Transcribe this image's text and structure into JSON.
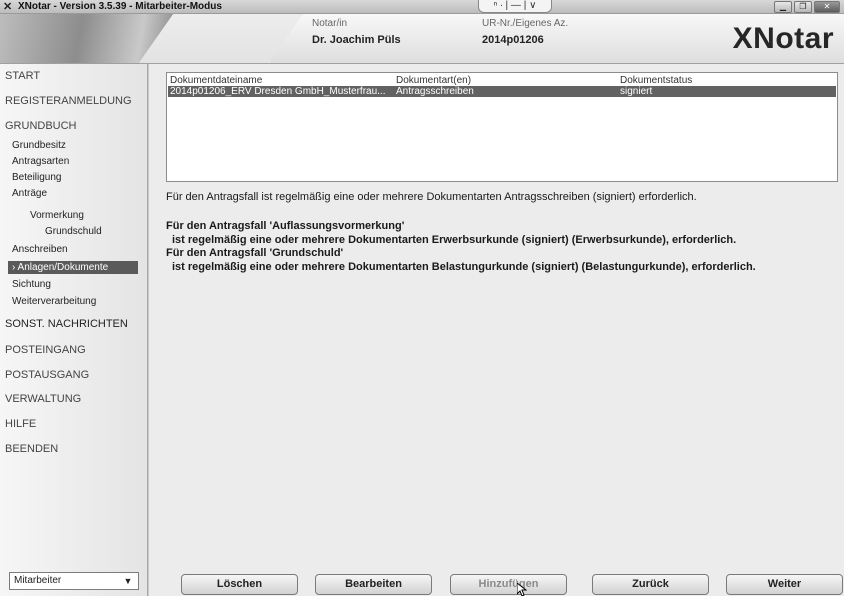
{
  "window": {
    "title": "XNotar - Version 3.5.39 - Mitarbeiter-Modus",
    "mid_indicator": "ⁿ ∙ | — | ∨"
  },
  "header": {
    "notar_label": "Notar/in",
    "notar_value": "Dr. Joachim Püls",
    "ur_label": "UR-Nr./Eigenes Az.",
    "ur_value": "2014p01206",
    "logo": "XNotar"
  },
  "sidebar": {
    "start": "START",
    "registeranmeldung": "REGISTERANMELDUNG",
    "grundbuch": "GRUNDBUCH",
    "grundbesitz": "Grundbesitz",
    "antragsarten": "Antragsarten",
    "beteiligung": "Beteiligung",
    "antraege": "Anträge",
    "vormerkung": "Vormerkung",
    "grundschuld": "Grundschuld",
    "anschreiben": "Anschreiben",
    "anlagen": "› Anlagen/Dokumente",
    "sichtung": "Sichtung",
    "weiterverarbeitung": "Weiterverarbeitung",
    "sonst_nachrichten": "SONST. NACHRICHTEN",
    "posteingang": "POSTEINGANG",
    "postausgang": "POSTAUSGANG",
    "verwaltung": "VERWALTUNG",
    "hilfe": "HILFE",
    "beenden": "BEENDEN",
    "role_select": "Mitarbeiter"
  },
  "table": {
    "columns": [
      "Dokumentdateiname",
      "Dokumentart(en)",
      "Dokumentstatus"
    ],
    "rows": [
      {
        "dateiname": "2014p01206_ERV Dresden GmbH_Musterfrau...",
        "art": "Antragsschreiben",
        "status": "signiert"
      }
    ]
  },
  "messages": {
    "m1": "Für den Antragsfall ist regelmäßig eine oder mehrere Dokumentarten Antragsschreiben (signiert) erforderlich.",
    "m2": "Für den Antragsfall 'Auflassungsvormerkung'",
    "m3": "ist regelmäßig eine oder mehrere Dokumentarten Erwerbsurkunde (signiert) (Erwerbsurkunde), erforderlich.",
    "m4": "Für den Antragsfall 'Grundschuld'",
    "m5": "ist regelmäßig eine oder mehrere Dokumentarten Belastungurkunde (signiert) (Belastungurkunde), erforderlich."
  },
  "buttons": {
    "loeschen": "Löschen",
    "bearbeiten": "Bearbeiten",
    "hinzufuegen": "Hinzufügen",
    "zurueck": "Zurück",
    "weiter": "Weiter"
  }
}
